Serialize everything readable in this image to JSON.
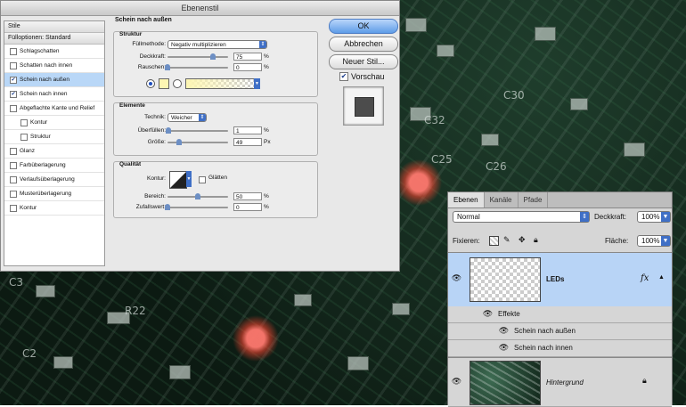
{
  "dialog": {
    "title": "Ebenenstil",
    "style_list": {
      "header": "Stile",
      "blend_options": "Fülloptionen: Standard",
      "items": [
        {
          "label": "Schlagschatten",
          "checked": false,
          "selected": false,
          "indent": false
        },
        {
          "label": "Schatten nach innen",
          "checked": false,
          "selected": false,
          "indent": false
        },
        {
          "label": "Schein nach außen",
          "checked": true,
          "selected": true,
          "indent": false
        },
        {
          "label": "Schein nach innen",
          "checked": true,
          "selected": false,
          "indent": false
        },
        {
          "label": "Abgeflachte Kante und Relief",
          "checked": false,
          "selected": false,
          "indent": false
        },
        {
          "label": "Kontur",
          "checked": false,
          "selected": false,
          "indent": true
        },
        {
          "label": "Struktur",
          "checked": false,
          "selected": false,
          "indent": true
        },
        {
          "label": "Glanz",
          "checked": false,
          "selected": false,
          "indent": false
        },
        {
          "label": "Farbüberlagerung",
          "checked": false,
          "selected": false,
          "indent": false
        },
        {
          "label": "Verlaufsüberlagerung",
          "checked": false,
          "selected": false,
          "indent": false
        },
        {
          "label": "Musterüberlagerung",
          "checked": false,
          "selected": false,
          "indent": false
        },
        {
          "label": "Kontur",
          "checked": false,
          "selected": false,
          "indent": false
        }
      ]
    },
    "panel_title": "Schein nach außen",
    "struktur": {
      "title": "Struktur",
      "blend_mode_label": "Füllmethode:",
      "blend_mode_value": "Negativ multiplizieren",
      "opacity_label": "Deckkraft:",
      "opacity_value": "75",
      "opacity_fraction": 0.75,
      "noise_label": "Rauschen:",
      "noise_value": "0",
      "noise_fraction": 0.0,
      "unit": "%"
    },
    "elemente": {
      "title": "Elemente",
      "technique_label": "Technik:",
      "technique_value": "Weicher",
      "spread_label": "Überfüllen:",
      "spread_value": "1",
      "spread_fraction": 0.01,
      "spread_unit": "%",
      "size_label": "Größe:",
      "size_value": "49",
      "size_fraction": 0.19,
      "size_unit": "Px"
    },
    "qualitaet": {
      "title": "Qualität",
      "contour_label": "Kontur:",
      "smooth_label": "Glätten",
      "range_label": "Bereich:",
      "range_value": "50",
      "range_fraction": 0.5,
      "jitter_label": "Zufallswert:",
      "jitter_value": "0",
      "jitter_fraction": 0.0,
      "unit": "%"
    },
    "buttons": {
      "ok": "OK",
      "cancel": "Abbrechen",
      "new_style": "Neuer Stil...",
      "preview": "Vorschau"
    },
    "colors": {
      "glow_color": "#fdf6b3",
      "accent": "#3f6fc6",
      "selection": "#b9d7f7"
    }
  },
  "layers_panel": {
    "tabs": [
      "Ebenen",
      "Kanäle",
      "Pfade"
    ],
    "blend_mode": "Normal",
    "opacity_label": "Deckkraft:",
    "opacity_value": "100%",
    "lock_label": "Fixieren:",
    "fill_label": "Fläche:",
    "fill_value": "100%",
    "layers": [
      {
        "name": "LEDs",
        "fx": "fx"
      },
      {
        "name": "Hintergrund"
      }
    ],
    "effects_label": "Effekte",
    "effects": [
      "Schein nach außen",
      "Schein nach innen"
    ]
  },
  "background": {
    "silkscreen": [
      "C30",
      "C32",
      "C26",
      "C25",
      "R22",
      "C3",
      "C2"
    ]
  }
}
